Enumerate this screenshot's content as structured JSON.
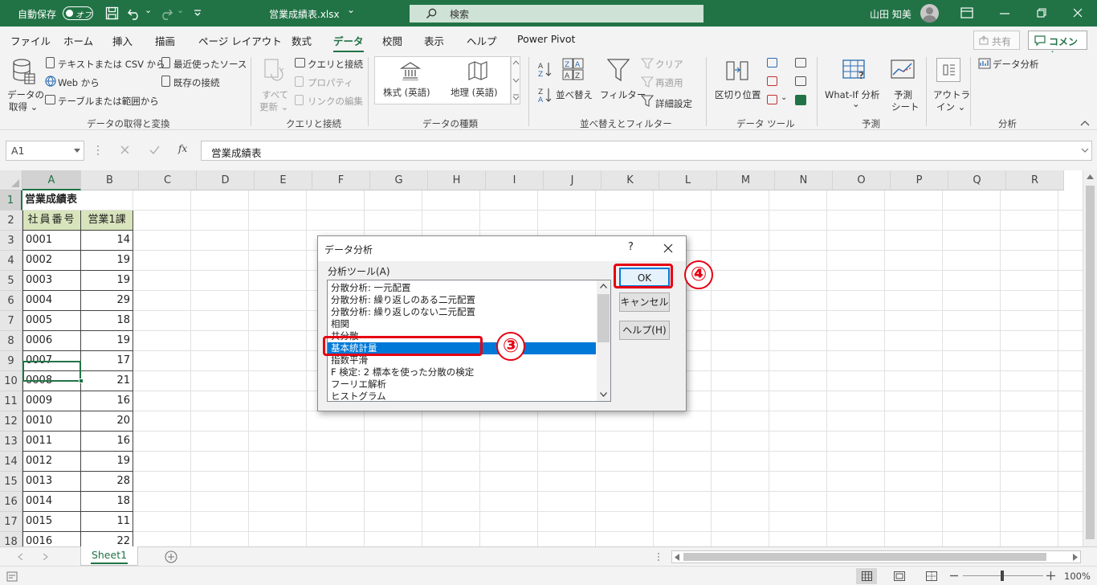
{
  "titlebar": {
    "autosave_label": "自動保存",
    "autosave_state": "オフ",
    "filename": "営業成績表.xlsx",
    "filename_chevron": "⌄",
    "search_placeholder": "検索",
    "user_name": "山田 知美"
  },
  "tabs": [
    "ファイル",
    "ホーム",
    "挿入",
    "描画",
    "ページ レイアウト",
    "数式",
    "データ",
    "校閲",
    "表示",
    "ヘルプ",
    "Power Pivot"
  ],
  "active_tab": "データ",
  "share_label": "共有",
  "comment_label": "コメント",
  "ribbon": {
    "get_data": {
      "btn1": "データの",
      "btn2": "取得 ⌄",
      "text_csv": "テキストまたは CSV から",
      "web": "Web から",
      "table_range": "テーブルまたは範囲から",
      "recent": "最近使ったソース",
      "existing": "既存の接続",
      "group": "データの取得と変換"
    },
    "queries": {
      "refresh1": "すべて",
      "refresh2": "更新 ⌄",
      "queries_conn": "クエリと接続",
      "properties": "プロパティ",
      "edit_links": "リンクの編集",
      "group": "クエリと接続"
    },
    "types": {
      "stocks": "株式 (英語)",
      "geography": "地理 (英語)",
      "group": "データの種類"
    },
    "sort": {
      "sort": "並べ替え",
      "filter": "フィルター",
      "clear": "クリア",
      "reapply": "再適用",
      "advanced": "詳細設定",
      "group": "並べ替えとフィルター"
    },
    "tools": {
      "text_to_col": "区切り位置",
      "group": "データ ツール"
    },
    "forecast": {
      "whatif": "What-If 分析",
      "whatif2": "⌄",
      "sheet1": "予測",
      "sheet2": "シート",
      "group": "予測"
    },
    "outline": {
      "label1": "アウトラ",
      "label2": "イン ⌄"
    },
    "analysis": {
      "data_analysis": "データ分析",
      "group": "分析"
    }
  },
  "formula_bar": {
    "name_box": "A1",
    "content": "営業成績表",
    "fx": "fx"
  },
  "columns": [
    "A",
    "B",
    "C",
    "D",
    "E",
    "F",
    "G",
    "H",
    "I",
    "J",
    "K",
    "L",
    "M",
    "N",
    "O",
    "P",
    "Q",
    "R"
  ],
  "rows": [
    {
      "n": "1",
      "a": "営業成績表",
      "b": ""
    },
    {
      "n": "2",
      "a": "社員番号",
      "b": "営業1課"
    },
    {
      "n": "3",
      "a": "0001",
      "b": "14"
    },
    {
      "n": "4",
      "a": "0002",
      "b": "19"
    },
    {
      "n": "5",
      "a": "0003",
      "b": "19"
    },
    {
      "n": "6",
      "a": "0004",
      "b": "29"
    },
    {
      "n": "7",
      "a": "0005",
      "b": "18"
    },
    {
      "n": "8",
      "a": "0006",
      "b": "19"
    },
    {
      "n": "9",
      "a": "0007",
      "b": "17"
    },
    {
      "n": "10",
      "a": "0008",
      "b": "21"
    },
    {
      "n": "11",
      "a": "0009",
      "b": "16"
    },
    {
      "n": "12",
      "a": "0010",
      "b": "20"
    },
    {
      "n": "13",
      "a": "0011",
      "b": "16"
    },
    {
      "n": "14",
      "a": "0012",
      "b": "19"
    },
    {
      "n": "15",
      "a": "0013",
      "b": "28"
    },
    {
      "n": "16",
      "a": "0014",
      "b": "18"
    },
    {
      "n": "17",
      "a": "0015",
      "b": "11"
    },
    {
      "n": "18",
      "a": "0016",
      "b": "22"
    }
  ],
  "sheet_tab": "Sheet1",
  "zoom": "100%",
  "dialog": {
    "title": "データ分析",
    "help_q": "?",
    "list_label": "分析ツール(A)",
    "items": [
      "分散分析: 一元配置",
      "分散分析: 繰り返しのある二元配置",
      "分散分析: 繰り返しのない二元配置",
      "相関",
      "共分散",
      "基本統計量",
      "指数平滑",
      "F 検定: 2 標本を使った分散の検定",
      "フーリエ解析",
      "ヒストグラム"
    ],
    "selected_index": 5,
    "ok": "OK",
    "cancel": "キャンセル",
    "help": "ヘルプ(H)"
  },
  "callouts": {
    "step3": "③",
    "step4": "④"
  },
  "colors": {
    "excel_green": "#217346",
    "selection_blue": "#0078d7",
    "annotation_red": "#e60012",
    "header_green": "#d8e4bc"
  }
}
